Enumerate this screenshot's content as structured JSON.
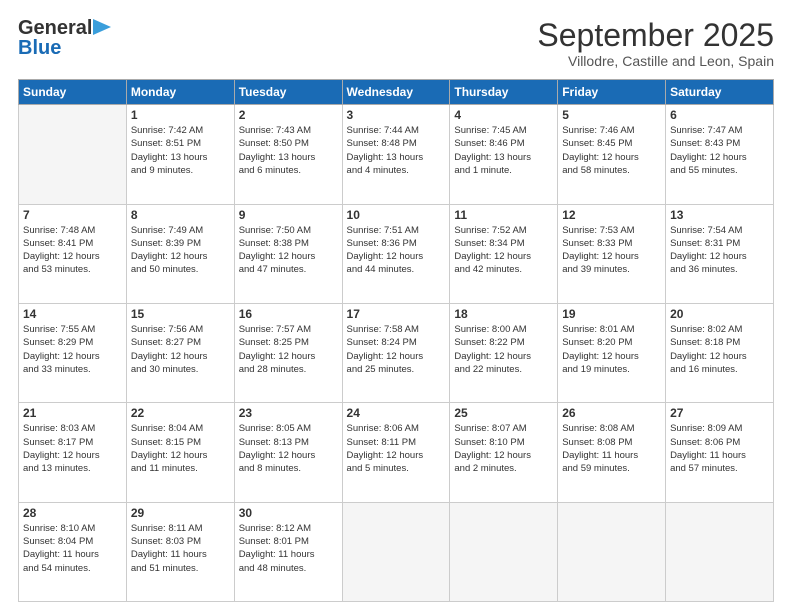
{
  "logo": {
    "general": "General",
    "blue": "Blue"
  },
  "title": "September 2025",
  "subtitle": "Villodre, Castille and Leon, Spain",
  "weekdays": [
    "Sunday",
    "Monday",
    "Tuesday",
    "Wednesday",
    "Thursday",
    "Friday",
    "Saturday"
  ],
  "weeks": [
    [
      {
        "day": "",
        "info": ""
      },
      {
        "day": "1",
        "info": "Sunrise: 7:42 AM\nSunset: 8:51 PM\nDaylight: 13 hours\nand 9 minutes."
      },
      {
        "day": "2",
        "info": "Sunrise: 7:43 AM\nSunset: 8:50 PM\nDaylight: 13 hours\nand 6 minutes."
      },
      {
        "day": "3",
        "info": "Sunrise: 7:44 AM\nSunset: 8:48 PM\nDaylight: 13 hours\nand 4 minutes."
      },
      {
        "day": "4",
        "info": "Sunrise: 7:45 AM\nSunset: 8:46 PM\nDaylight: 13 hours\nand 1 minute."
      },
      {
        "day": "5",
        "info": "Sunrise: 7:46 AM\nSunset: 8:45 PM\nDaylight: 12 hours\nand 58 minutes."
      },
      {
        "day": "6",
        "info": "Sunrise: 7:47 AM\nSunset: 8:43 PM\nDaylight: 12 hours\nand 55 minutes."
      }
    ],
    [
      {
        "day": "7",
        "info": "Sunrise: 7:48 AM\nSunset: 8:41 PM\nDaylight: 12 hours\nand 53 minutes."
      },
      {
        "day": "8",
        "info": "Sunrise: 7:49 AM\nSunset: 8:39 PM\nDaylight: 12 hours\nand 50 minutes."
      },
      {
        "day": "9",
        "info": "Sunrise: 7:50 AM\nSunset: 8:38 PM\nDaylight: 12 hours\nand 47 minutes."
      },
      {
        "day": "10",
        "info": "Sunrise: 7:51 AM\nSunset: 8:36 PM\nDaylight: 12 hours\nand 44 minutes."
      },
      {
        "day": "11",
        "info": "Sunrise: 7:52 AM\nSunset: 8:34 PM\nDaylight: 12 hours\nand 42 minutes."
      },
      {
        "day": "12",
        "info": "Sunrise: 7:53 AM\nSunset: 8:33 PM\nDaylight: 12 hours\nand 39 minutes."
      },
      {
        "day": "13",
        "info": "Sunrise: 7:54 AM\nSunset: 8:31 PM\nDaylight: 12 hours\nand 36 minutes."
      }
    ],
    [
      {
        "day": "14",
        "info": "Sunrise: 7:55 AM\nSunset: 8:29 PM\nDaylight: 12 hours\nand 33 minutes."
      },
      {
        "day": "15",
        "info": "Sunrise: 7:56 AM\nSunset: 8:27 PM\nDaylight: 12 hours\nand 30 minutes."
      },
      {
        "day": "16",
        "info": "Sunrise: 7:57 AM\nSunset: 8:25 PM\nDaylight: 12 hours\nand 28 minutes."
      },
      {
        "day": "17",
        "info": "Sunrise: 7:58 AM\nSunset: 8:24 PM\nDaylight: 12 hours\nand 25 minutes."
      },
      {
        "day": "18",
        "info": "Sunrise: 8:00 AM\nSunset: 8:22 PM\nDaylight: 12 hours\nand 22 minutes."
      },
      {
        "day": "19",
        "info": "Sunrise: 8:01 AM\nSunset: 8:20 PM\nDaylight: 12 hours\nand 19 minutes."
      },
      {
        "day": "20",
        "info": "Sunrise: 8:02 AM\nSunset: 8:18 PM\nDaylight: 12 hours\nand 16 minutes."
      }
    ],
    [
      {
        "day": "21",
        "info": "Sunrise: 8:03 AM\nSunset: 8:17 PM\nDaylight: 12 hours\nand 13 minutes."
      },
      {
        "day": "22",
        "info": "Sunrise: 8:04 AM\nSunset: 8:15 PM\nDaylight: 12 hours\nand 11 minutes."
      },
      {
        "day": "23",
        "info": "Sunrise: 8:05 AM\nSunset: 8:13 PM\nDaylight: 12 hours\nand 8 minutes."
      },
      {
        "day": "24",
        "info": "Sunrise: 8:06 AM\nSunset: 8:11 PM\nDaylight: 12 hours\nand 5 minutes."
      },
      {
        "day": "25",
        "info": "Sunrise: 8:07 AM\nSunset: 8:10 PM\nDaylight: 12 hours\nand 2 minutes."
      },
      {
        "day": "26",
        "info": "Sunrise: 8:08 AM\nSunset: 8:08 PM\nDaylight: 11 hours\nand 59 minutes."
      },
      {
        "day": "27",
        "info": "Sunrise: 8:09 AM\nSunset: 8:06 PM\nDaylight: 11 hours\nand 57 minutes."
      }
    ],
    [
      {
        "day": "28",
        "info": "Sunrise: 8:10 AM\nSunset: 8:04 PM\nDaylight: 11 hours\nand 54 minutes."
      },
      {
        "day": "29",
        "info": "Sunrise: 8:11 AM\nSunset: 8:03 PM\nDaylight: 11 hours\nand 51 minutes."
      },
      {
        "day": "30",
        "info": "Sunrise: 8:12 AM\nSunset: 8:01 PM\nDaylight: 11 hours\nand 48 minutes."
      },
      {
        "day": "",
        "info": ""
      },
      {
        "day": "",
        "info": ""
      },
      {
        "day": "",
        "info": ""
      },
      {
        "day": "",
        "info": ""
      }
    ]
  ]
}
